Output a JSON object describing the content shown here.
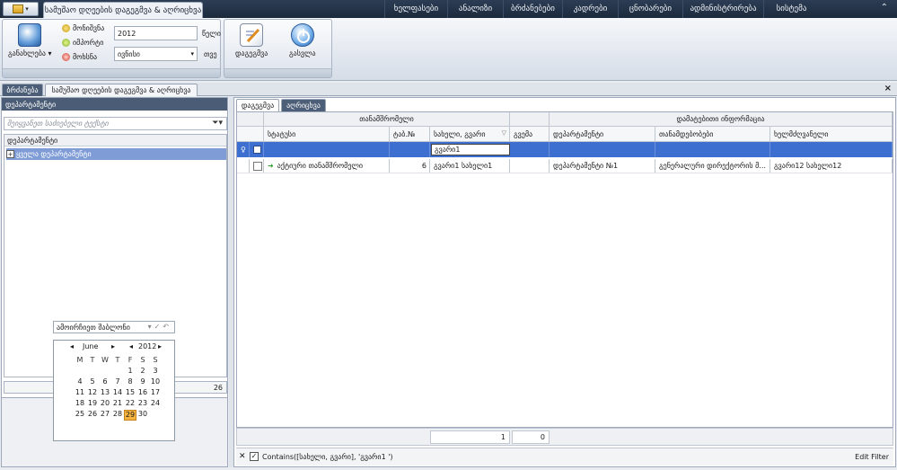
{
  "menubar": {
    "active_tab": "სამუშაო დღეების დაგეგმვა & აღრიცხვა",
    "items": [
      "ხელფასები",
      "ანალიზი",
      "ბრძანებები",
      "კადრები",
      "ცნობარები",
      "ადმინისტრირება",
      "სისტემა"
    ]
  },
  "ribbon": {
    "generate_label": "განახლება",
    "small": [
      "მონიშვნა",
      "იმპორტი",
      "მოხსნა"
    ],
    "year_value": "2012",
    "year_label": "წელი",
    "month_value": "ივნისი",
    "month_label": "თვე",
    "plan_label": "დაგეგმვა",
    "exit_label": "გასვლა"
  },
  "doctabs": [
    "ბრძანება",
    "სამუშაო დღეების დაგეგმვა & აღრიცხვა"
  ],
  "left": {
    "header": "დეპარტამენტი",
    "filter_placeholder": "შეიყვანეთ საძიებელი ტექსტი",
    "tree_header": "დეპარტამენტი",
    "tree_node": "ყველა დეპარტამენტი",
    "count": "26",
    "date_mode": "ამოირჩიეთ შაბლონი"
  },
  "calendar": {
    "month": "June",
    "year": "2012",
    "weekdays": [
      "M",
      "T",
      "W",
      "T",
      "F",
      "S",
      "S"
    ],
    "leading_blanks": 4,
    "days": [
      "1",
      "2",
      "3",
      "4",
      "5",
      "6",
      "7",
      "8",
      "9",
      "10",
      "11",
      "12",
      "13",
      "14",
      "15",
      "16",
      "17",
      "18",
      "19",
      "20",
      "21",
      "22",
      "23",
      "24",
      "25",
      "26",
      "27",
      "28",
      "29",
      "30"
    ],
    "today": "29"
  },
  "right": {
    "tabs": [
      "დაგეგმვა",
      "აღრიცხვა"
    ],
    "bands": [
      "თანამშრომელი",
      "დამატებითი ინფორმაცია"
    ],
    "columns": [
      "სტატუსი",
      "ტაბ.№",
      "სახელი, გვარი",
      "გვემა",
      "დეპარტამენტი",
      "თანამდებობები",
      "ხელმძღვანელი"
    ],
    "filter_value": "გვარი1",
    "row": {
      "status": "აქტიური თანამშრომელი",
      "tab_no": "6",
      "name": "გვარი1 სახელი1",
      "schedule": "",
      "department": "დეპარტამენტი №1",
      "position": "გენერალური დირექტორის მ...",
      "manager": "გვარი12 სახელი12"
    },
    "footer_count": "1",
    "footer_sum": "0",
    "filter_text": "Contains([სახელი, გვარი], 'გვარი1 ')",
    "edit_filter": "Edit Filter"
  },
  "colors": {
    "accent": "#3d6fd0",
    "header_dark": "#4a5c76",
    "menubar": "#1c2a3c",
    "today": "#f4b23e"
  }
}
